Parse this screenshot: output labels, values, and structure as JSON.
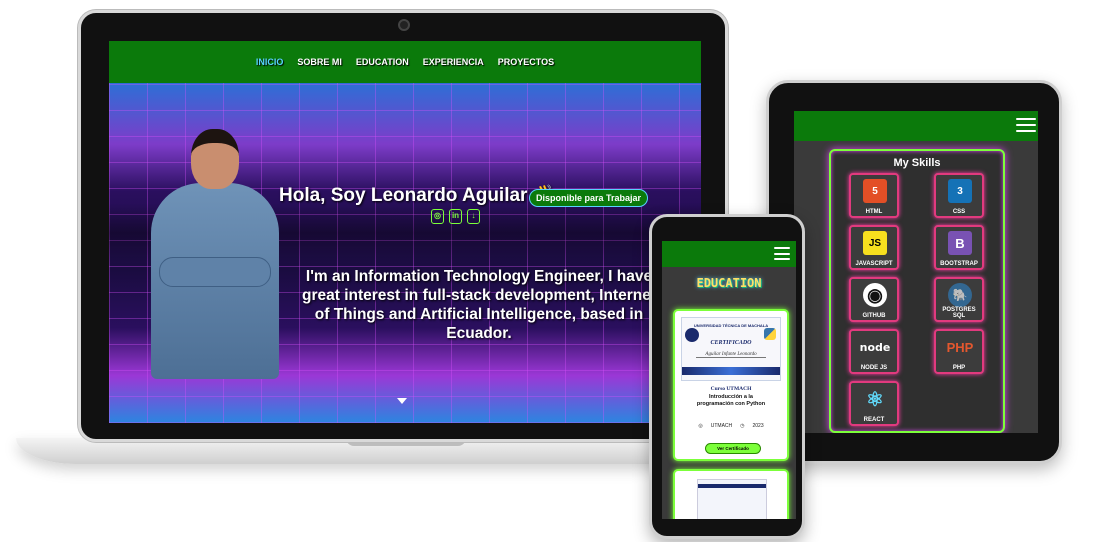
{
  "laptop": {
    "nav": {
      "items": [
        "INICIO",
        "SOBRE MI",
        "EDUCATION",
        "EXPERIENCIA",
        "PROYECTOS"
      ],
      "active": "INICIO"
    },
    "hero": {
      "greeting": "Hola, Soy Leonardo Aguilar 👋",
      "status_badge": "Disponible para Trabajar",
      "social_icons": [
        "github-icon",
        "linkedin-icon",
        "download-icon"
      ],
      "about": "I'm an Information Technology Engineer, I have great interest in full-stack development, Internet of Things and Artificial Intelligence, based in Ecuador."
    }
  },
  "tablet": {
    "menu_icon": "hamburger-menu-icon",
    "skills_title": "My Skills",
    "skills": [
      {
        "label": "HTML",
        "icon": "html5-icon",
        "color": "#e34f26",
        "glyph": "5"
      },
      {
        "label": "CSS",
        "icon": "css3-icon",
        "color": "#1572b6",
        "glyph": "3"
      },
      {
        "label": "JAVASCRIPT",
        "icon": "javascript-icon",
        "color": "#f7df1e",
        "glyph": "JS"
      },
      {
        "label": "BOOTSTRAP",
        "icon": "bootstrap-icon",
        "color": "#7952b3",
        "glyph": "B"
      },
      {
        "label": "GITHUB",
        "icon": "github-icon",
        "color": "#111111",
        "glyph": "◉"
      },
      {
        "label": "POSTGRES SQL",
        "icon": "postgresql-icon",
        "color": "#336791",
        "glyph": "🐘"
      },
      {
        "label": "NODE JS",
        "icon": "nodejs-icon",
        "color": "#3c3c3c",
        "glyph": "node"
      },
      {
        "label": "PHP",
        "icon": "php-icon",
        "color": "#3c3c3c",
        "glyph": "PHP"
      },
      {
        "label": "REACT",
        "icon": "react-icon",
        "color": "#3c3c3c",
        "glyph": "⚛"
      }
    ]
  },
  "phone": {
    "menu_icon": "hamburger-menu-icon",
    "section_title": "EDUCATION",
    "certificate": {
      "image_header": "UNIVERSIDAD TÉCNICA DE MACHALA",
      "image_title": "CERTIFICADO",
      "image_signature": "Aguilar Infante Leonardo",
      "name_line1": "Curso UTMACH",
      "name_line2": "Introducción a la",
      "name_line3": "programación con Python",
      "institution": "UTMACH",
      "year": "2023",
      "button": "Ver Certificado"
    }
  },
  "colors": {
    "nav_green": "#0b7a0b",
    "active_nav": "#58d4ff",
    "neon_green": "#7cff3a",
    "neon_pink": "#e23a7e"
  }
}
